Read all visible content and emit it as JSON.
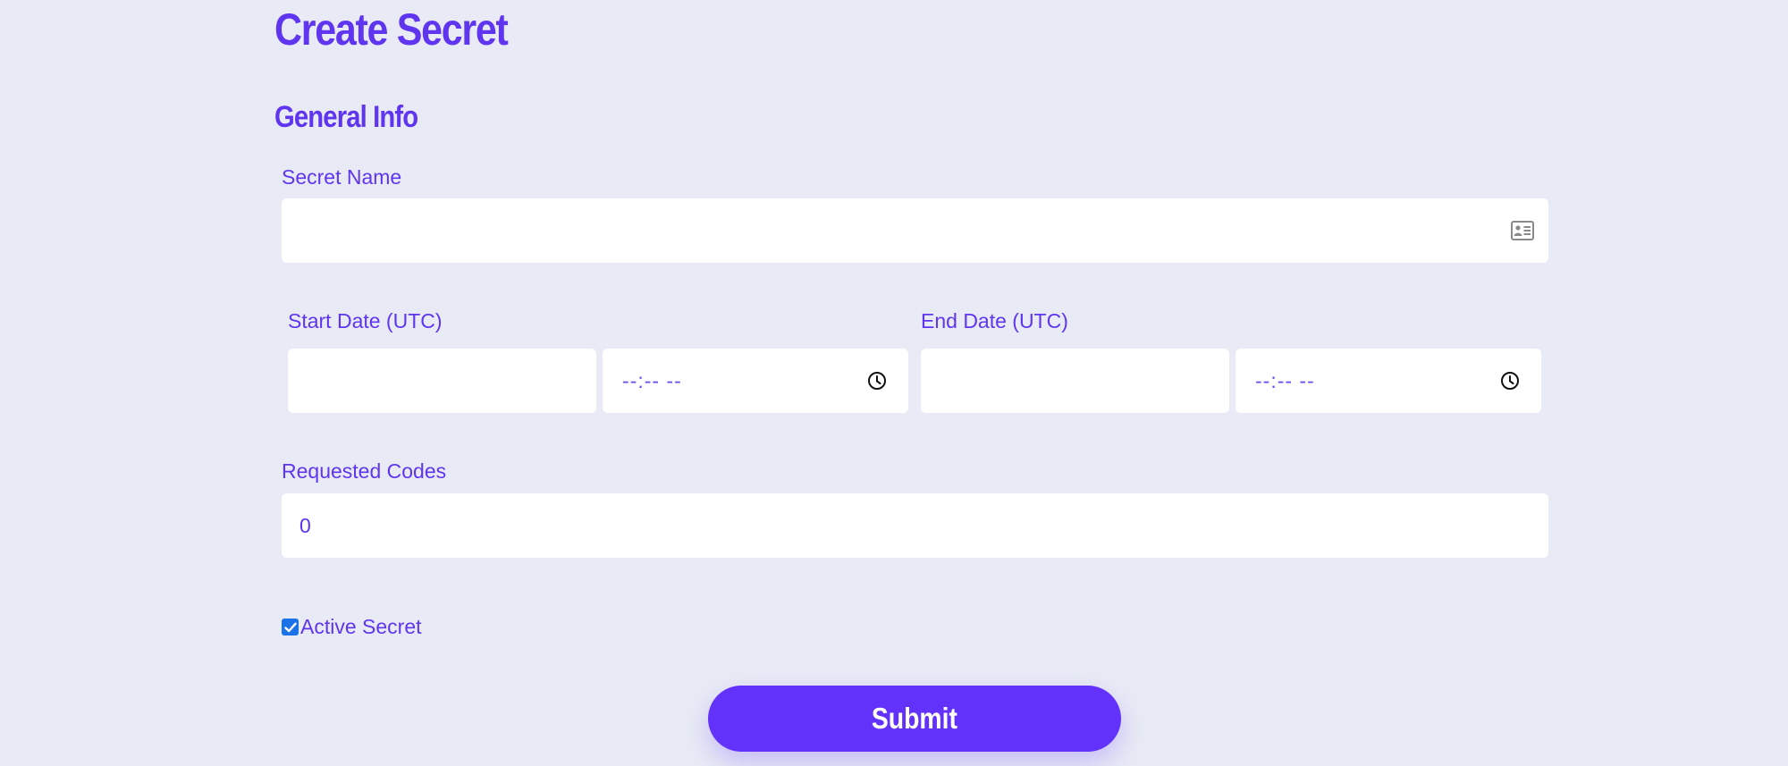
{
  "page": {
    "title": "Create Secret",
    "section_title": "General Info"
  },
  "form": {
    "secret_name": {
      "label": "Secret Name",
      "value": "",
      "icon": "contact-card-icon"
    },
    "start_date": {
      "label": "Start Date (UTC)",
      "date_value": "",
      "time_placeholder": "--:-- --",
      "icon": "clock-icon"
    },
    "end_date": {
      "label": "End Date (UTC)",
      "date_value": "",
      "time_placeholder": "--:-- --",
      "icon": "clock-icon"
    },
    "requested_codes": {
      "label": "Requested Codes",
      "value": "0"
    },
    "active_secret": {
      "label": "Active Secret",
      "checked": true
    },
    "submit_label": "Submit"
  },
  "colors": {
    "accent": "#5f35ef",
    "button": "#6232fa",
    "background": "#e8ebf5",
    "checkbox": "#1a73e8"
  }
}
